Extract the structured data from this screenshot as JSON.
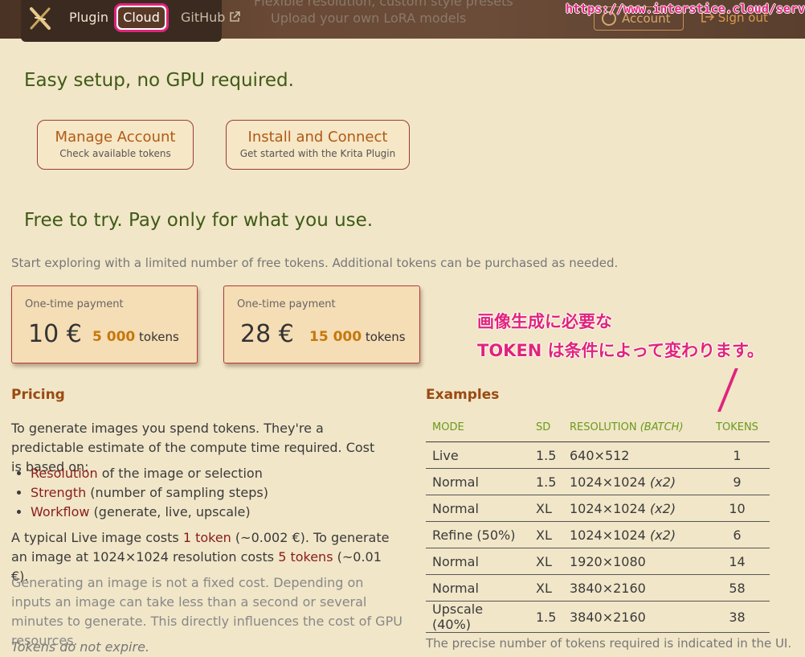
{
  "nav": {
    "plugin": "Plugin",
    "cloud": "Cloud",
    "github": "GitHub",
    "feature_1": "Flexible resolution, custom style presets",
    "feature_2": "Upload your own LoRA models",
    "account": "Account",
    "sign_out": "Sign out"
  },
  "annotation_url": "https://www.interstice.cloud/service",
  "setup": {
    "heading": "Easy setup, no GPU required.",
    "manage_title": "Manage Account",
    "manage_sub": "Check available tokens",
    "install_title": "Install and Connect",
    "install_sub": "Get started with the Krita Plugin"
  },
  "free": {
    "heading": "Free to try. Pay only for what you use.",
    "intro": "Start exploring with a limited number of free tokens. Additional tokens can be purchased as needed."
  },
  "cards": [
    {
      "label": "One-time payment",
      "price": "10 €",
      "tokens": "5 000",
      "unit": "tokens"
    },
    {
      "label": "One-time payment",
      "price": "28 €",
      "tokens": "15 000",
      "unit": "tokens"
    }
  ],
  "jp_annotation": {
    "line1": "画像生成に必要な",
    "line2": "TOKEN は条件によって変わります。"
  },
  "pricing": {
    "heading": "Pricing",
    "p1": "To generate images you spend tokens. They're a predictable estimate of the compute time required. Cost is based on:",
    "bullets": [
      {
        "term": "Resolution",
        "rest": " of the image or selection"
      },
      {
        "term": "Strength",
        "rest": " (number of sampling steps)"
      },
      {
        "term": "Workflow",
        "rest": " (generate, live, upscale)"
      }
    ],
    "p2_a": "A typical Live image costs ",
    "p2_b": "1 token",
    "p2_c": " (~0.002 €). To generate an image at 1024×1024 resolution costs ",
    "p2_d": "5 tokens",
    "p2_e": " (~0.01 €).",
    "p3": "Generating an image is not a fixed cost. Depending on inputs an image can take less than a second or several minutes to generate. This directly influences the cost of GPU resources.",
    "p4": "Tokens do not expire."
  },
  "examples": {
    "heading": "Examples",
    "headers": {
      "mode": "MODE",
      "sd": "SD",
      "res": "RESOLUTION",
      "batch": "(BATCH)",
      "tokens": "TOKENS"
    },
    "rows": [
      {
        "mode": "Live",
        "sd": "1.5",
        "res": "640×512",
        "batch": "",
        "tokens": "1"
      },
      {
        "mode": "Normal",
        "sd": "1.5",
        "res": "1024×1024",
        "batch": "(x2)",
        "tokens": "9"
      },
      {
        "mode": "Normal",
        "sd": "XL",
        "res": "1024×1024",
        "batch": "(x2)",
        "tokens": "10"
      },
      {
        "mode": "Refine (50%)",
        "sd": "XL",
        "res": "1024×1024",
        "batch": "(x2)",
        "tokens": "6"
      },
      {
        "mode": "Normal",
        "sd": "XL",
        "res": "1920×1080",
        "batch": "",
        "tokens": "14"
      },
      {
        "mode": "Normal",
        "sd": "XL",
        "res": "3840×2160",
        "batch": "",
        "tokens": "58"
      },
      {
        "mode": "Upscale (40%)",
        "sd": "1.5",
        "res": "3840×2160",
        "batch": "",
        "tokens": "38"
      }
    ],
    "footer": "The precise number of tokens required is indicated in the UI."
  }
}
